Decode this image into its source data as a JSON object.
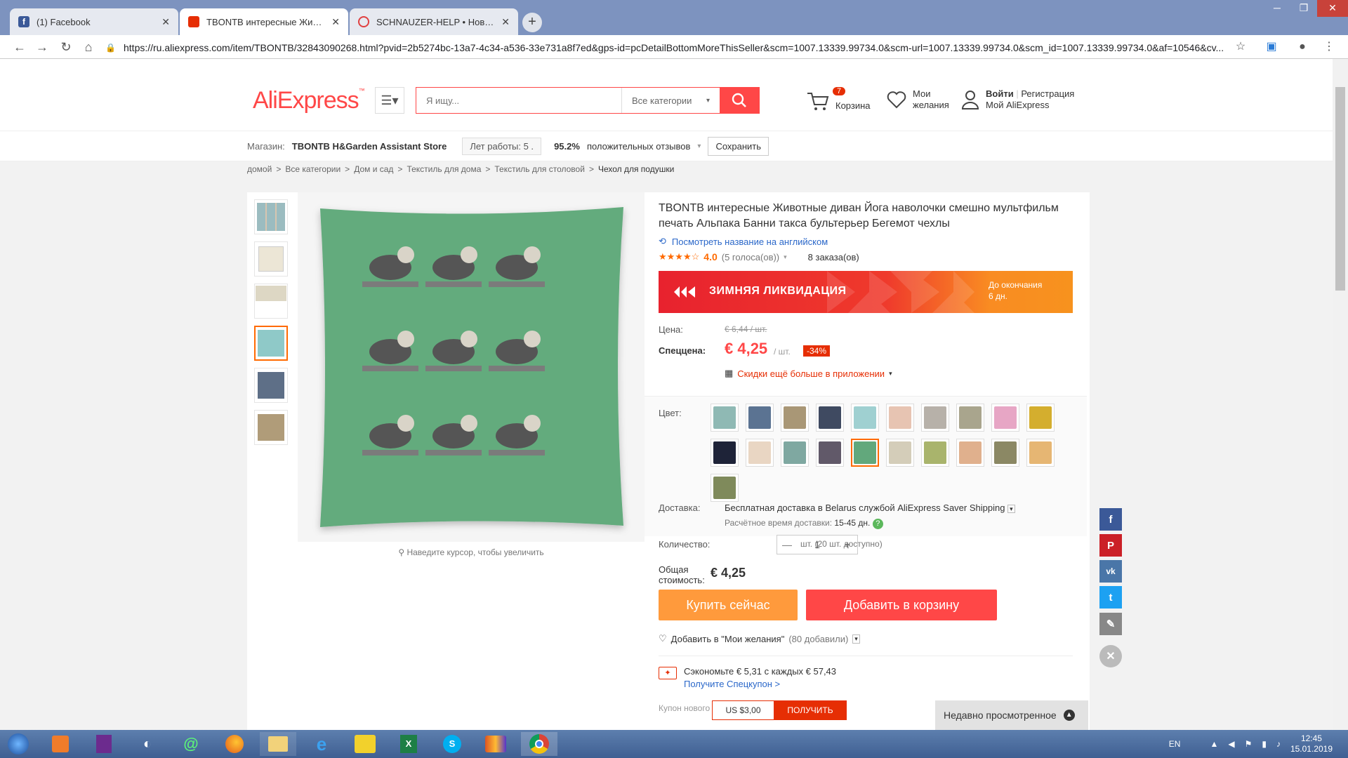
{
  "browser": {
    "tabs": [
      {
        "title": "(1) Facebook",
        "favicon": "facebook-icon"
      },
      {
        "title": "TBONTB интересные Животные",
        "favicon": "aliexpress-icon"
      },
      {
        "title": "SCHNAUZER-HELP • Новые сооб",
        "favicon": "forum-icon"
      }
    ],
    "url": "https://ru.aliexpress.com/item/TBONTB/32843090268.html?pvid=2b5274bc-13a7-4c34-a536-33e731a8f7ed&gps-id=pcDetailBottomMoreThisSeller&scm=1007.13339.99734.0&scm-url=1007.13339.99734.0&scm_id=1007.13339.99734.0&af=10546&cv..."
  },
  "header": {
    "logo": "AliExpress",
    "search_placeholder": "Я ищу...",
    "all_categories": "Все категории",
    "cart_count": "7",
    "cart_label": "Корзина",
    "wishlist_line1": "Мои",
    "wishlist_line2": "желания",
    "login": "Войти",
    "register": "Регистрация",
    "my_aliexpress": "Мой AliExpress"
  },
  "store": {
    "label": "Магазин:",
    "name": "TBONTB H&Garden Assistant Store",
    "years": "Лет работы: 5 .",
    "positive": "95.2%",
    "positive_label": "положительных отзывов",
    "save": "Сохранить"
  },
  "breadcrumb": [
    "домой",
    "Все категории",
    "Дом и сад",
    "Текстиль для дома",
    "Текстиль для столовой",
    "Чехол для подушки"
  ],
  "product": {
    "title": "TBONTB интересные Животные диван Йога наволочки смешно мультфильм печать Альпака Банни такса бультерьер Бегемот чехлы",
    "view_english": "Посмотреть название на английском",
    "rating": "4.0",
    "votes": "(5 голоса(ов))",
    "orders": "8 заказа(ов)",
    "zoom_hint": "Наведите курсор, чтобы увеличить",
    "banner_title": "ЗИМНЯЯ ЛИКВИДАЦИЯ",
    "banner_end1": "До окончания",
    "banner_end2": "6 дн.",
    "price_label": "Цена:",
    "old_price": "€ 6,44 / шт.",
    "special_label": "Спеццена:",
    "new_price": "€ 4,25",
    "unit": "/ шт.",
    "discount": "-34%",
    "app_discount": "Скидки ещё больше в приложении",
    "color_label": "Цвет:",
    "delivery_label": "Доставка:",
    "delivery_text": "Бесплатная доставка в Belarus службой AliExpress Saver Shipping",
    "delivery_time_label": "Расчётное время доставки:",
    "delivery_time": "15-45 дн.",
    "qty_label": "Количество:",
    "qty": "1",
    "qty_available": "шт. (20 шт. доступно)",
    "total_label1": "Общая",
    "total_label2": "стоимость:",
    "total": "€ 4,25",
    "buy_now": "Купить сейчас",
    "add_cart": "Добавить в корзину",
    "add_wish": "Добавить в \"Мои желания\"",
    "wish_count": "(80 добавили)",
    "save_text": "Сэкономьте € 5,31 с каждых € 57,43",
    "get_coupon": "Получите Спецкупон >",
    "new_coupon": "Купон нового",
    "coupon_value": "US $3,00",
    "coupon_get": "ПОЛУЧИТЬ"
  },
  "colors": {
    "accent": "#ff4747",
    "orange": "#ff6a00",
    "swatches": [
      "#8fb9b4",
      "#5b7392",
      "#a99776",
      "#3f4a61",
      "#9fd0d1",
      "#e7c4b2",
      "#b7b1a9",
      "#a9a58d",
      "#e7a6c5",
      "#d4ae2e",
      "#1e2338",
      "#e9d6c3",
      "#7fa8a1",
      "#615969",
      "#62a87c",
      "#d4cdb9",
      "#a9b46c",
      "#e0b08d",
      "#8b8864",
      "#e6b673",
      "#7f8a5b"
    ],
    "selected_index": 14
  },
  "recent": "Недавно просмотренное",
  "taskbar": {
    "lang": "EN",
    "time": "12:45",
    "date": "15.01.2019"
  }
}
